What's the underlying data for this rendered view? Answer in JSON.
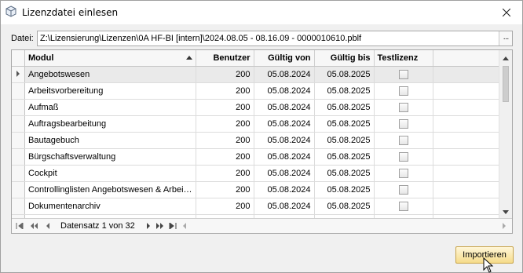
{
  "window": {
    "title": "Lizenzdatei einlesen",
    "close_label": "✕"
  },
  "file": {
    "label": "Datei:",
    "value": "Z:\\Lizensierung\\Lizenzen\\0A HF-BI [intern]\\2024.08.05 - 08.16.09 - 0000010610.pblf",
    "browse_label": "···"
  },
  "grid": {
    "columns": [
      "Modul",
      "Benutzer",
      "Gültig von",
      "Gültig bis",
      "Testlizenz"
    ],
    "sort_column": "Modul",
    "sort_direction": "ascending",
    "rows": [
      {
        "modul": "Angebotswesen",
        "benutzer": "200",
        "von": "05.08.2024",
        "bis": "05.08.2025",
        "test": false
      },
      {
        "modul": "Arbeitsvorbereitung",
        "benutzer": "200",
        "von": "05.08.2024",
        "bis": "05.08.2025",
        "test": false
      },
      {
        "modul": "Aufmaß",
        "benutzer": "200",
        "von": "05.08.2024",
        "bis": "05.08.2025",
        "test": false
      },
      {
        "modul": "Auftragsbearbeitung",
        "benutzer": "200",
        "von": "05.08.2024",
        "bis": "05.08.2025",
        "test": false
      },
      {
        "modul": "Bautagebuch",
        "benutzer": "200",
        "von": "05.08.2024",
        "bis": "05.08.2025",
        "test": false
      },
      {
        "modul": "Bürgschaftsverwaltung",
        "benutzer": "200",
        "von": "05.08.2024",
        "bis": "05.08.2025",
        "test": false
      },
      {
        "modul": "Cockpit",
        "benutzer": "200",
        "von": "05.08.2024",
        "bis": "05.08.2025",
        "test": false
      },
      {
        "modul": "Controllinglisten Angebotswesen & Arbei…",
        "benutzer": "200",
        "von": "05.08.2024",
        "bis": "05.08.2025",
        "test": false
      },
      {
        "modul": "Dokumentenarchiv",
        "benutzer": "200",
        "von": "05.08.2024",
        "bis": "05.08.2025",
        "test": false
      },
      {
        "modul": "",
        "benutzer": "",
        "von": "",
        "bis": "",
        "test": false
      }
    ],
    "selected_row": 0
  },
  "navigator": {
    "record_text": "Datensatz 1 von 32",
    "first_icon": "first-record-icon",
    "prev_page_icon": "previous-page-icon",
    "prev_icon": "previous-record-icon",
    "next_icon": "next-record-icon",
    "next_page_icon": "next-page-icon",
    "last_icon": "last-record-icon"
  },
  "actions": {
    "import_label": "Importieren"
  },
  "colors": {
    "accent_button": "#f6dc8a",
    "selected_row": "#eaeaea"
  }
}
